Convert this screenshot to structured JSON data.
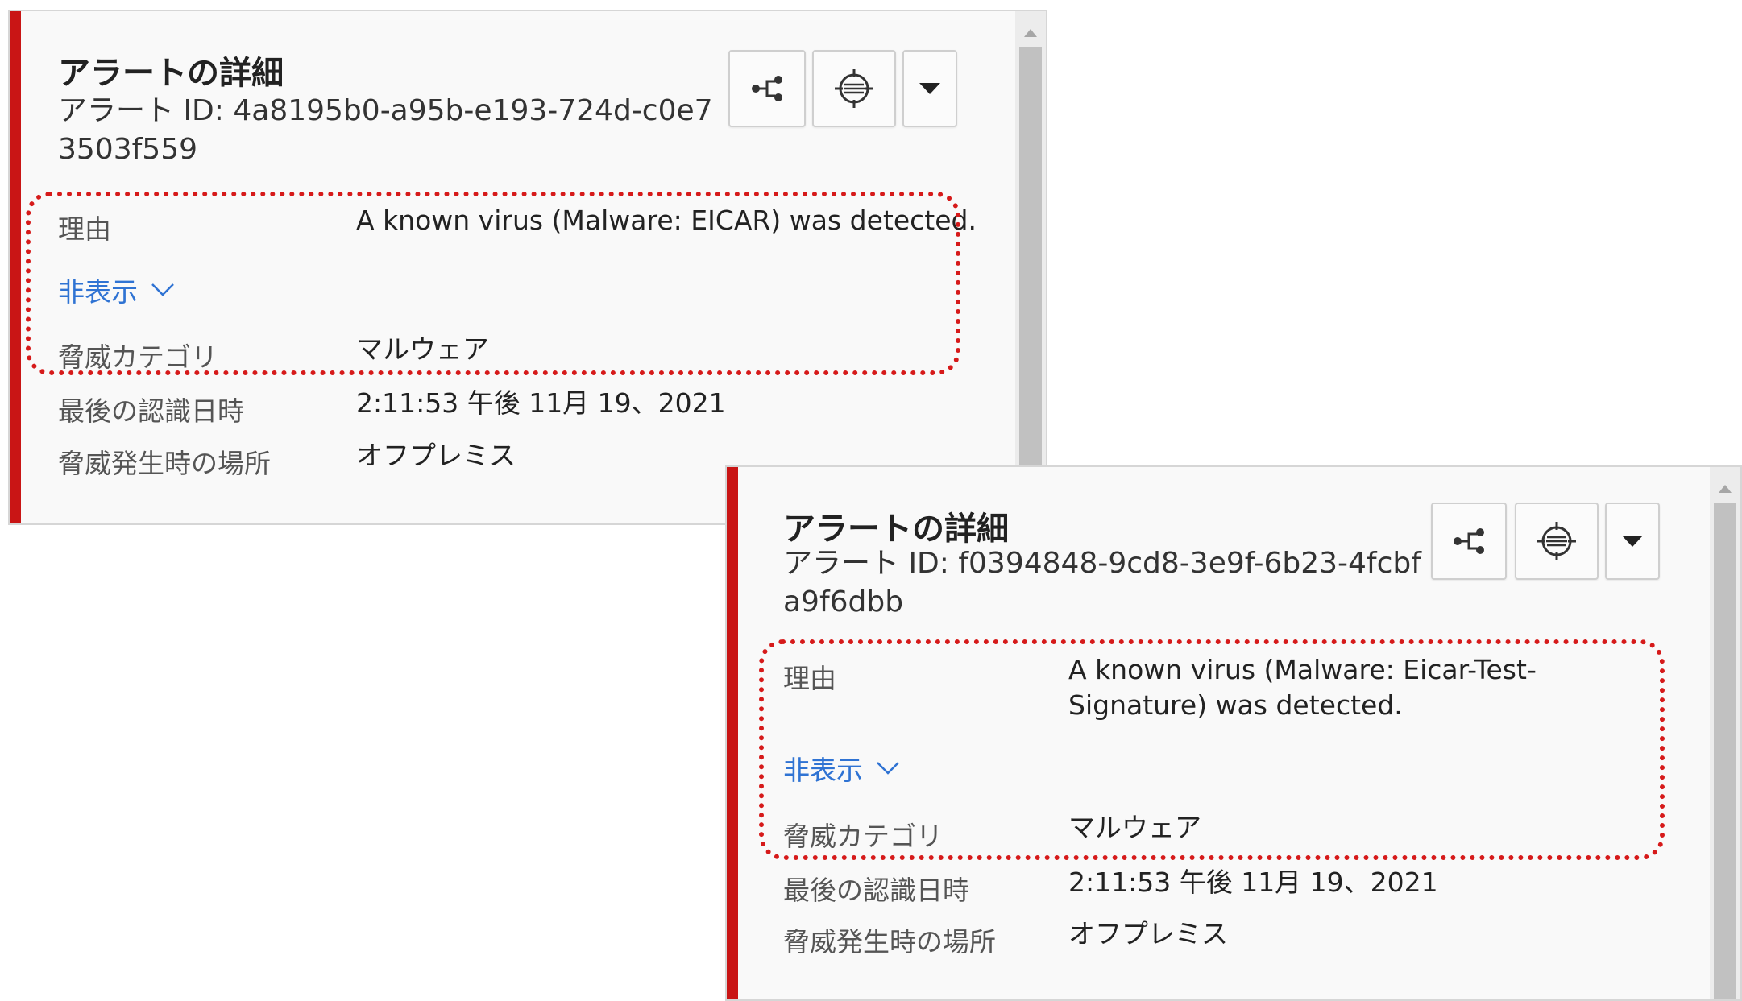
{
  "cards": [
    {
      "title": "アラートの詳細",
      "alert_id": "アラート ID: 4a8195b0-a95b-e193-724d-c0e73503f559",
      "actions": {
        "graph_icon": "share-network-icon",
        "target_icon": "crosshair-globe-icon",
        "menu_icon": "caret-down-icon"
      },
      "reason_label": "理由",
      "reason_value": "A known virus (Malware: EICAR) was detected.",
      "toggle_label": "非表示",
      "category_label": "脅威カテゴリ",
      "category_value": "マルウェア",
      "last_seen_label": "最後の認識日時",
      "last_seen_value": "2:11:53 午後 11月 19、2021",
      "location_label": "脅威発生時の場所",
      "location_value": "オフプレミス"
    },
    {
      "title": "アラートの詳細",
      "alert_id": "アラート ID: f0394848-9cd8-3e9f-6b23-4fcbfa9f6dbb",
      "actions": {
        "graph_icon": "share-network-icon",
        "target_icon": "crosshair-globe-icon",
        "menu_icon": "caret-down-icon"
      },
      "reason_label": "理由",
      "reason_value": "A known virus (Malware: Eicar-Test-Signature) was detected.",
      "toggle_label": "非表示",
      "category_label": "脅威カテゴリ",
      "category_value": "マルウェア",
      "last_seen_label": "最後の認識日時",
      "last_seen_value": "2:11:53 午後 11月 19、2021",
      "location_label": "脅威発生時の場所",
      "location_value": "オフプレミス"
    }
  ],
  "colors": {
    "accent": "#c91515",
    "link": "#2f73d3",
    "highlight": "#d61a1a"
  }
}
